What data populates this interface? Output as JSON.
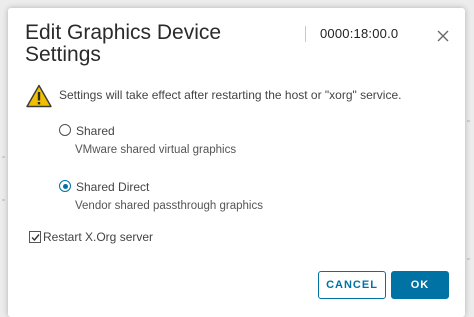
{
  "dialog": {
    "title": "Edit Graphics Device Settings",
    "device_id": "0000:18:00.0",
    "warning_text": "Settings will take effect after restarting the host or \"xorg\" service.",
    "options": [
      {
        "label": "Shared",
        "description": "VMware shared virtual graphics",
        "selected": false
      },
      {
        "label": "Shared Direct",
        "description": "Vendor shared passthrough graphics",
        "selected": true
      }
    ],
    "restart_checkbox": {
      "label": "Restart X.Org server",
      "checked": true
    },
    "buttons": {
      "cancel_label": "CANCEL",
      "ok_label": "OK"
    }
  },
  "colors": {
    "accent": "#0072a3",
    "warning": "#f0c000"
  },
  "icons": {
    "close": "close-icon",
    "warning": "warning-icon",
    "check": "checkmark-icon"
  }
}
